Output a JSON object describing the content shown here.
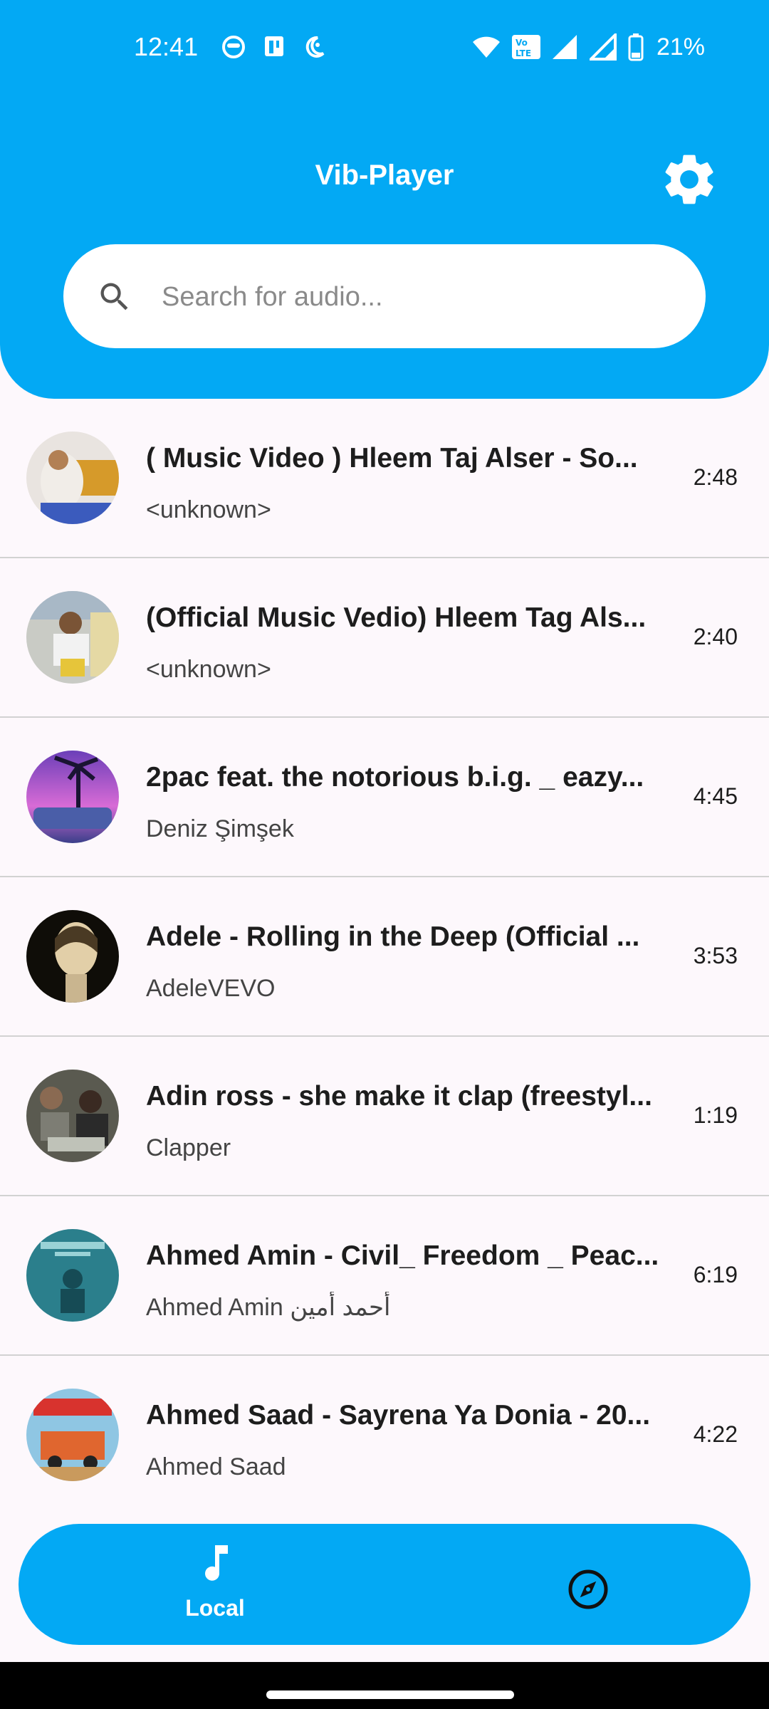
{
  "status_bar": {
    "time": "12:41",
    "battery": "21%",
    "left_icons": [
      "ghost-notification-icon",
      "clipboard-notification-icon",
      "do-not-disturb-moon-icon"
    ],
    "right_icons": [
      "wifi-icon",
      "volte-icon",
      "signal-r-icon",
      "signal-icon",
      "battery-icon"
    ]
  },
  "header": {
    "title": "Vib-Player",
    "settings_icon": "gear-icon",
    "accent_color": "#03a9f4"
  },
  "search": {
    "placeholder": "Search for audio...",
    "value": ""
  },
  "tracks": [
    {
      "title": "( Music Video )  Hleem Taj Alser - So...",
      "artist": "<unknown>",
      "duration": "2:48"
    },
    {
      "title": "(Official Music Vedio) Hleem Tag Als...",
      "artist": "<unknown>",
      "duration": "2:40"
    },
    {
      "title": "2pac feat. the notorious b.i.g. _ eazy...",
      "artist": "Deniz Şimşek",
      "duration": "4:45"
    },
    {
      "title": "Adele - Rolling in the Deep (Official ...",
      "artist": "AdeleVEVO",
      "duration": "3:53"
    },
    {
      "title": "Adin ross - she make it clap (freestyl...",
      "artist": "Clapper",
      "duration": "1:19"
    },
    {
      "title": "Ahmed Amin - Civil_ Freedom _ Peac...",
      "artist": "Ahmed Amin أحمد أمين",
      "duration": "6:19"
    },
    {
      "title": "Ahmed Saad - Sayrena Ya Donia - 20...",
      "artist": "Ahmed Saad",
      "duration": "4:22"
    }
  ],
  "bottom_nav": {
    "local_label": "Local",
    "local_icon": "music-note-icon",
    "explore_icon": "compass-icon"
  }
}
